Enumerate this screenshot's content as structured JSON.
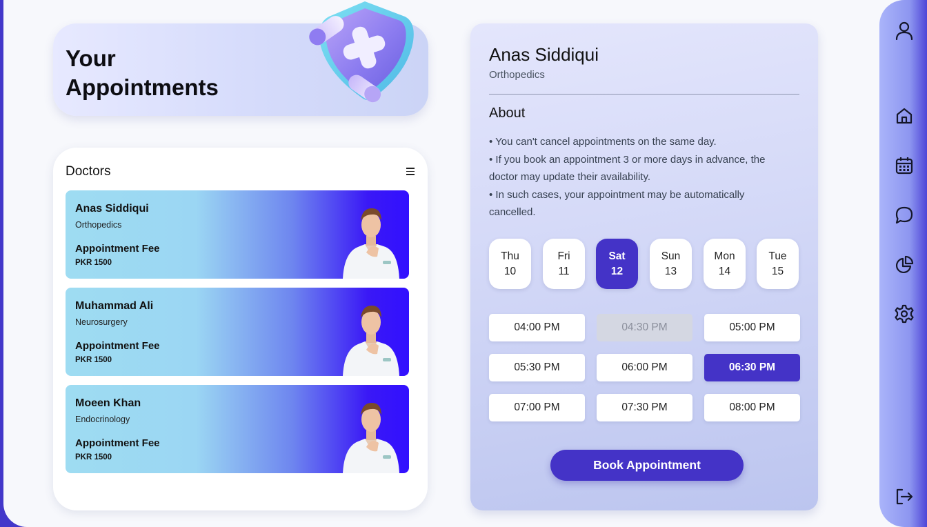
{
  "hero": {
    "title_line1": "Your",
    "title_line2": "Appointments"
  },
  "doctors_panel": {
    "title": "Doctors",
    "cards": [
      {
        "name": "Anas Siddiqui",
        "specialty": "Orthopedics",
        "fee_label": "Appointment Fee",
        "fee": "PKR 1500"
      },
      {
        "name": "Muhammad Ali",
        "specialty": "Neurosurgery",
        "fee_label": "Appointment Fee",
        "fee": "PKR 1500"
      },
      {
        "name": "Moeen Khan",
        "specialty": "Endocrinology",
        "fee_label": "Appointment Fee",
        "fee": "PKR 1500"
      }
    ]
  },
  "detail": {
    "name": "Anas Siddiqui",
    "specialty": "Orthopedics",
    "about_title": "About",
    "about_lines": [
      "• You can't cancel appointments on the same day.",
      "• If you book an appointment 3 or more days in advance, the doctor may update their availability.",
      "• In such cases, your appointment may be automatically cancelled."
    ],
    "dates": [
      {
        "day": "Thu",
        "num": "10",
        "selected": false
      },
      {
        "day": "Fri",
        "num": "11",
        "selected": false
      },
      {
        "day": "Sat",
        "num": "12",
        "selected": true
      },
      {
        "day": "Sun",
        "num": "13",
        "selected": false
      },
      {
        "day": "Mon",
        "num": "14",
        "selected": false
      },
      {
        "day": "Tue",
        "num": "15",
        "selected": false
      }
    ],
    "slots": [
      {
        "label": "04:00 PM",
        "state": "available"
      },
      {
        "label": "04:30 PM",
        "state": "disabled"
      },
      {
        "label": "05:00 PM",
        "state": "available"
      },
      {
        "label": "05:30 PM",
        "state": "available"
      },
      {
        "label": "06:00 PM",
        "state": "available"
      },
      {
        "label": "06:30 PM",
        "state": "selected"
      },
      {
        "label": "07:00 PM",
        "state": "available"
      },
      {
        "label": "07:30 PM",
        "state": "available"
      },
      {
        "label": "08:00 PM",
        "state": "available"
      }
    ],
    "book_label": "Book Appointment"
  },
  "sidebar": {
    "icons": [
      "user-icon",
      "home-icon",
      "calendar-icon",
      "chat-icon",
      "pie-chart-icon",
      "settings-icon",
      "logout-icon"
    ]
  },
  "colors": {
    "accent": "#4433c7",
    "frame": "#4338ca",
    "disabled_slot": "#d4d7e2"
  }
}
